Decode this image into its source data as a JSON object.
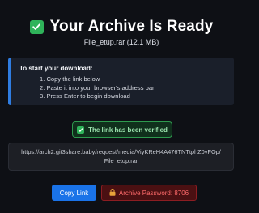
{
  "header": {
    "title": "Your Archive Is Ready",
    "file_name": "File_etup.rar",
    "file_size": "(12.1 MB)"
  },
  "instructions": {
    "heading": "To start your download:",
    "steps": [
      "1. Copy the link below",
      "2. Paste it into your browser's address bar",
      "3. Press Enter to begin download"
    ]
  },
  "verified": {
    "label": "The link has been verified"
  },
  "link": {
    "url": "https://arch2.git3share.baby/request/media/ViyKReH4A476TNTtphZ0vFOp/File_etup.rar"
  },
  "actions": {
    "copy_label": "Copy Link",
    "password_label": "Archive Password: 8706"
  },
  "colors": {
    "success": "#2fb35a",
    "accent": "#1a73e8",
    "danger": "#ff6b6b"
  }
}
